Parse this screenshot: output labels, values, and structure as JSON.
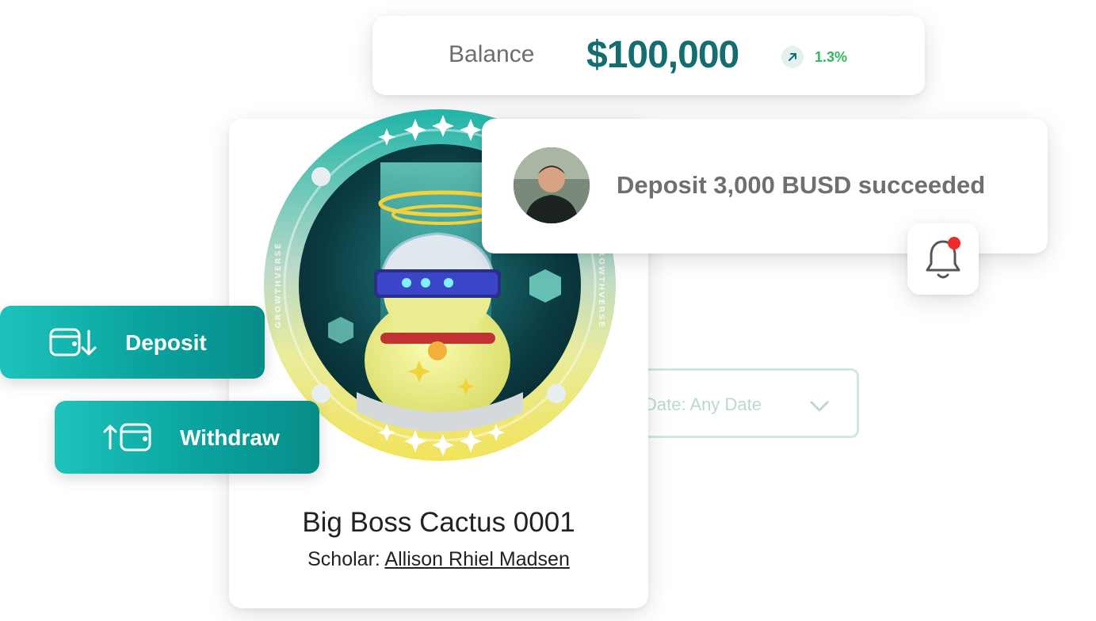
{
  "balance": {
    "label": "Balance",
    "value": "$100,000",
    "trend": "1.3%",
    "trend_icon": "arrow-up-right-icon",
    "value_color": "#146d70",
    "trend_color": "#2fb95a"
  },
  "notification": {
    "message": "Deposit 3,000 BUSD succeeded",
    "avatar_icon": "user-avatar",
    "bell_icon": "bell-icon",
    "has_unread": true
  },
  "filter": {
    "label": "Date: Any Date"
  },
  "nft": {
    "title": "Big Boss Cactus 0001",
    "scholar_prefix": "Scholar:",
    "scholar_name": "Allison Rhiel Madsen",
    "coin_text": "GROWTHVERSE"
  },
  "actions": {
    "deposit_label": "Deposit",
    "deposit_icon": "wallet-deposit-icon",
    "withdraw_label": "Withdraw",
    "withdraw_icon": "wallet-withdraw-icon"
  }
}
